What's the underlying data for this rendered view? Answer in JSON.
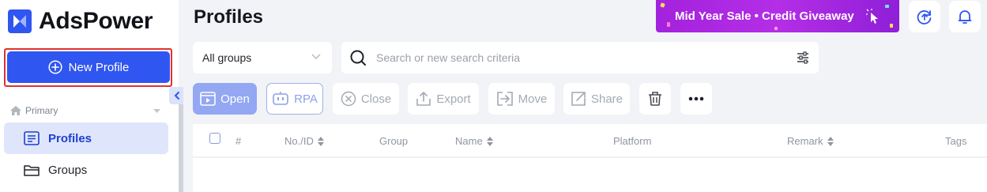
{
  "app": {
    "name": "AdsPower"
  },
  "sidebar": {
    "new_profile_label": "New Profile",
    "section_label": "Primary",
    "items": [
      {
        "label": "Profiles",
        "active": true,
        "icon": "profiles-list-icon"
      },
      {
        "label": "Groups",
        "active": false,
        "icon": "folder-icon"
      }
    ]
  },
  "header": {
    "title": "Profiles",
    "promo_text": "Mid Year Sale • Credit Giveaway",
    "icons": [
      "sync-upload-icon",
      "bell-icon"
    ]
  },
  "filters": {
    "group_select_value": "All groups",
    "search_placeholder": "Search or new search criteria"
  },
  "toolbar": {
    "open_label": "Open",
    "rpa_label": "RPA",
    "close_label": "Close",
    "export_label": "Export",
    "move_label": "Move",
    "share_label": "Share"
  },
  "table": {
    "columns": [
      {
        "label": "#",
        "sortable": false
      },
      {
        "label": "No./ID",
        "sortable": true
      },
      {
        "label": "Group",
        "sortable": false
      },
      {
        "label": "Name",
        "sortable": true
      },
      {
        "label": "Platform",
        "sortable": false
      },
      {
        "label": "Remark",
        "sortable": true
      },
      {
        "label": "Tags",
        "sortable": false
      }
    ]
  },
  "colors": {
    "brand": "#2f56f0",
    "promo_purple": "#a322dd",
    "highlight_outline": "#e0322c",
    "active_nav_bg": "#dfe6fb"
  }
}
